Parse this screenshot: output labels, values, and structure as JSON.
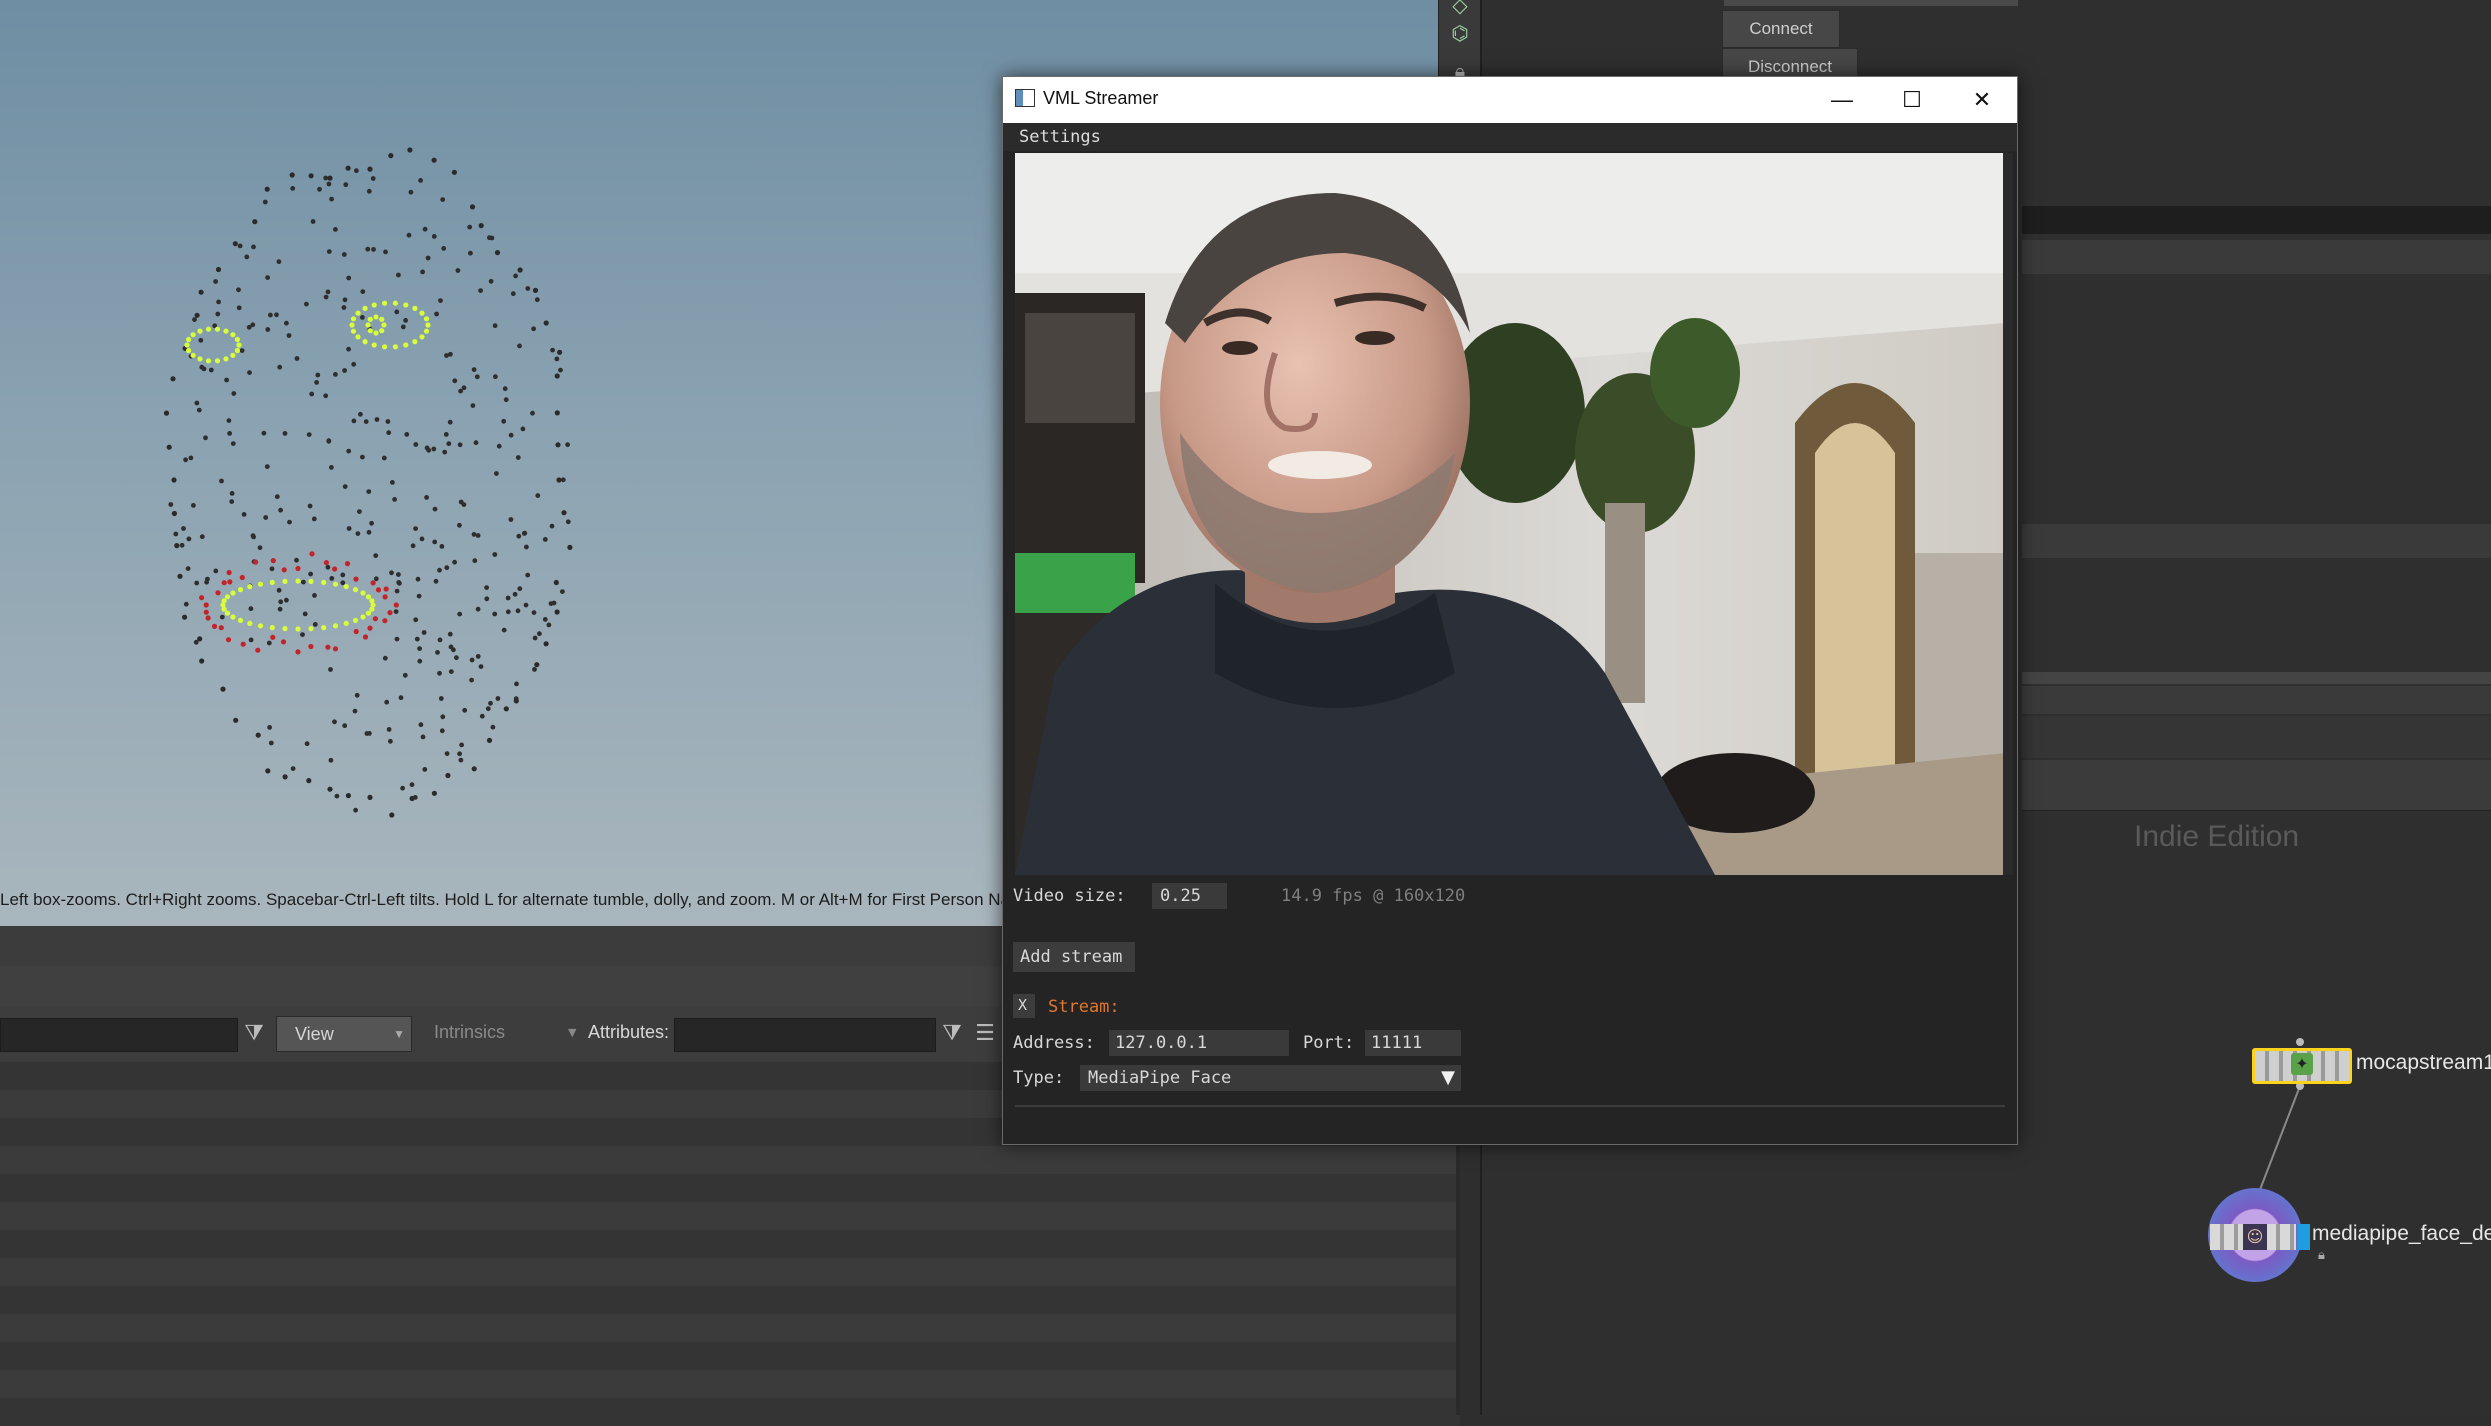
{
  "viewport": {
    "hint": "Left box-zooms. Ctrl+Right zooms. Spacebar-Ctrl-Left tilts. Hold L for alternate tumble, dolly, and zoom. M or Alt+M for First Person Navi"
  },
  "parm_bar": {
    "view_label": "View",
    "intrinsics_label": "Intrinsics",
    "attributes_label": "Attributes:"
  },
  "right_panel": {
    "connect_label": "Connect",
    "disconnect_label": "Disconnect",
    "watermark": "Indie Edition",
    "nodes": [
      {
        "name": "mocapstream1"
      },
      {
        "name": "mediapipe_face_dec"
      }
    ]
  },
  "vml_window": {
    "title": "VML Streamer",
    "menu": [
      "Settings"
    ],
    "video_size_label": "Video size:",
    "video_size_value": "0.25",
    "fps_text": "14.9 fps @ 160x120",
    "add_stream_label": "Add stream",
    "remove_glyph": "X",
    "stream_label": "Stream:",
    "address_label": "Address:",
    "address_value": "127.0.0.1",
    "port_label": "Port:",
    "port_value": "11111",
    "type_label": "Type:",
    "type_value": "MediaPipe Face"
  },
  "icons": {
    "minimize": "minimize-icon",
    "maximize": "maximize-icon",
    "close": "close-icon",
    "dropdown": "triangle-down-icon",
    "filter": "filter-icon"
  }
}
